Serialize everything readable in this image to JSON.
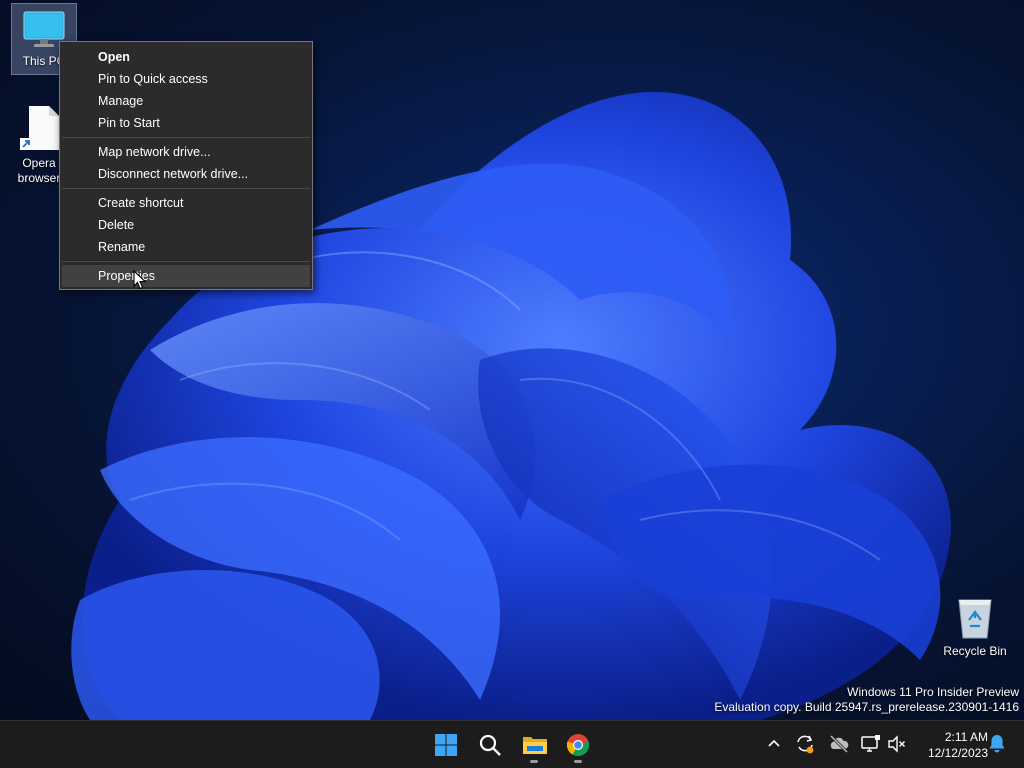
{
  "desktop": {
    "icons": [
      {
        "label": "This PC"
      },
      {
        "label": "Opera browser"
      },
      {
        "label": "Recycle Bin"
      }
    ]
  },
  "context_menu": {
    "items": [
      {
        "label": "Open"
      },
      {
        "label": "Pin to Quick access"
      },
      {
        "label": "Manage"
      },
      {
        "label": "Pin to Start"
      },
      {
        "label": "Map network drive..."
      },
      {
        "label": "Disconnect network drive..."
      },
      {
        "label": "Create shortcut"
      },
      {
        "label": "Delete"
      },
      {
        "label": "Rename"
      },
      {
        "label": "Properties"
      }
    ]
  },
  "watermark": {
    "line1": "Windows 11 Pro Insider Preview",
    "line2": "Evaluation copy. Build 25947.rs_prerelease.230901-1416"
  },
  "taskbar": {
    "apps": [
      {
        "icon": "windows-start-icon"
      },
      {
        "icon": "search-icon"
      },
      {
        "icon": "file-explorer-icon"
      },
      {
        "icon": "chrome-icon"
      }
    ],
    "tray_icons": [
      "chevron-up-icon",
      "sync-icon",
      "cloud-offline-icon",
      "network-icon",
      "volume-muted-icon",
      "bell-icon"
    ],
    "clock": {
      "time": "2:11 AM",
      "date": "12/12/2023"
    }
  },
  "colors": {
    "menu_bg": "#2b2b2b",
    "menu_hover": "#414141",
    "taskbar_bg": "#1c1c1c",
    "accent": "#0078d4"
  }
}
